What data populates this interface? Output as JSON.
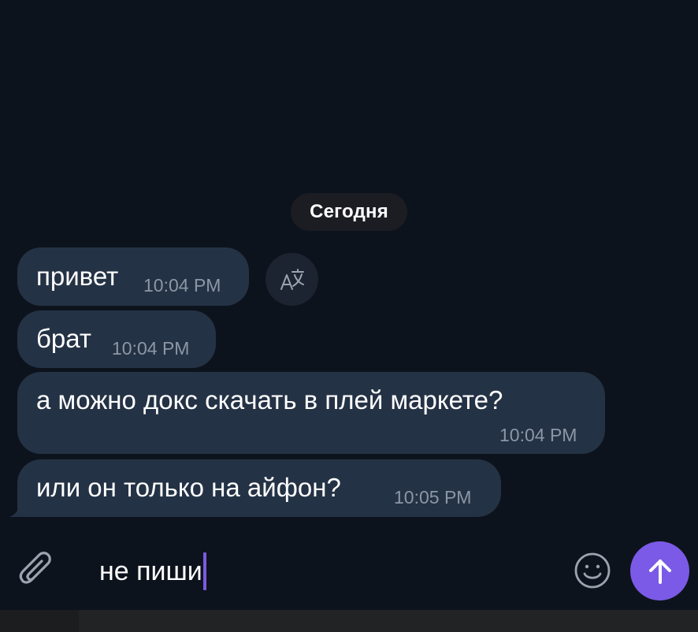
{
  "chat": {
    "date_label": "Сегодня",
    "messages": [
      {
        "text": "привет",
        "time": "10:04 PM"
      },
      {
        "text": "брат",
        "time": "10:04 PM"
      },
      {
        "text": "а можно докс скачать в плей маркете?",
        "time": "10:04 PM"
      },
      {
        "text": "или он только на айфон?",
        "time": "10:05 PM"
      }
    ]
  },
  "composer": {
    "input_value": "не пиши"
  },
  "icons": {
    "translate": "translate-icon",
    "attach": "paperclip-icon",
    "emoji": "smiley-icon",
    "send": "arrow-up-icon"
  },
  "colors": {
    "background": "#0d131c",
    "bubble": "#243245",
    "timestamp": "#8c97a6",
    "accent": "#7a5ae6",
    "caret": "#7c5ae0"
  }
}
